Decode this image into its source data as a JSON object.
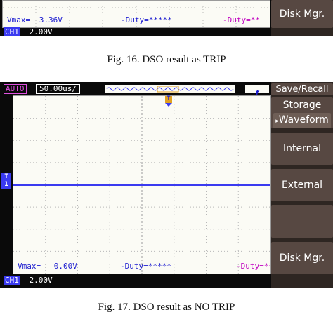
{
  "figure1": {
    "caption": "Fig. 16. DSO result as TRIP",
    "vmax_label": "Vmax=",
    "vmax_value": "3.36V",
    "duty1": "-Duty=*****",
    "duty2": "-Duty=**",
    "ch_label": "CH1",
    "ch_scale": "2.00V",
    "menu_button": "Disk Mgr."
  },
  "figure2": {
    "caption": "Fig. 17. DSO result as NO TRIP",
    "mode": "AUTO",
    "timebase": "50.00us/",
    "trigger_icon": "f",
    "trigger_marker": "T",
    "channel_marker_top": "T",
    "channel_marker_bottom": "1",
    "vmax_label": "Vmax=",
    "vmax_value": "0.00V",
    "duty1": "-Duty=*****",
    "duty2": "-Duty=**",
    "ch_label": "CH1",
    "ch_scale": "2.00V",
    "menu": {
      "title": "Save/Recall",
      "storage": "Storage",
      "waveform": "Waveform",
      "internal": "Internal",
      "external": "External",
      "disk": "Disk Mgr."
    }
  },
  "colors": {
    "trace": "#3a3af0",
    "marker_orange": "#e0a020",
    "duty_magenta": "#c000c0",
    "duty_blue": "#1a1ad0",
    "menu_bg": "#574842"
  }
}
